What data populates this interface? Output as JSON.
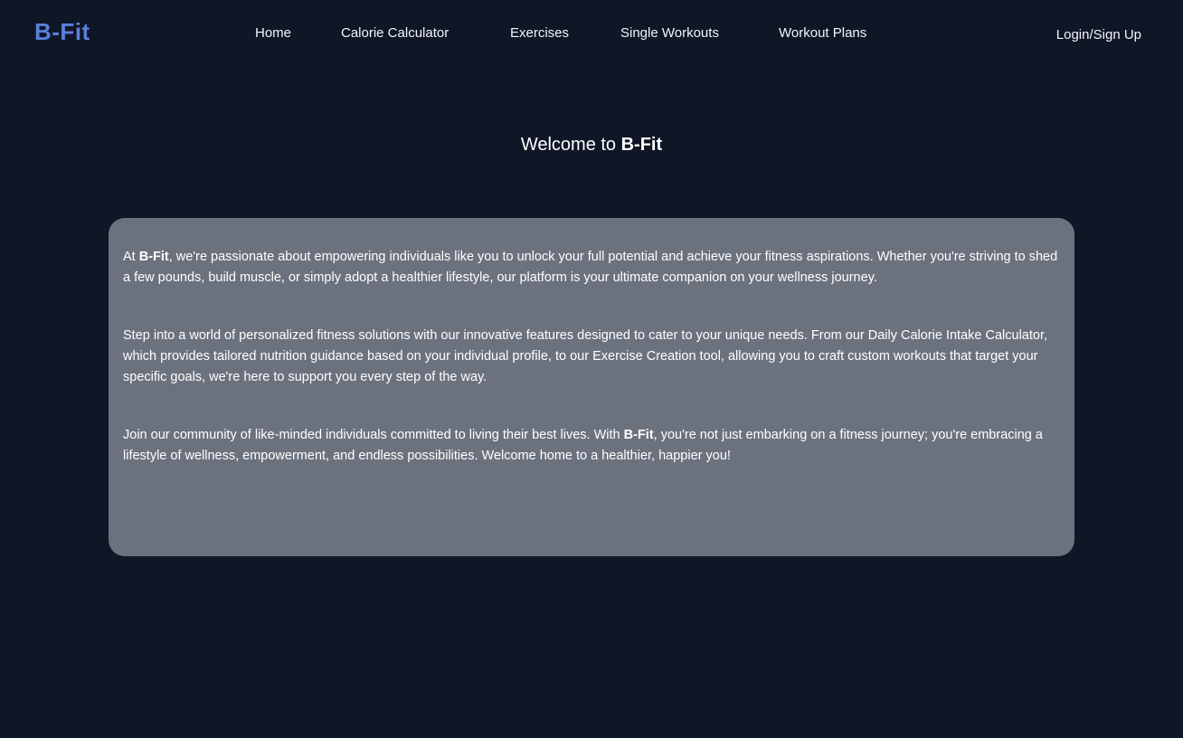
{
  "brand": {
    "name": "B-Fit",
    "color": "#5b7fdc"
  },
  "nav": {
    "items": [
      {
        "label": "Home"
      },
      {
        "label": "Calorie Calculator"
      },
      {
        "label": "Exercises"
      },
      {
        "label": "Single Workouts"
      },
      {
        "label": "Workout Plans"
      }
    ],
    "login_label": "Login/Sign Up"
  },
  "hero": {
    "prefix": "Welcome to ",
    "brand": "B-Fit"
  },
  "about": {
    "p1": {
      "pre": "At ",
      "brand": "B-Fit",
      "post": ", we're passionate about empowering individuals like you to unlock your full potential and achieve your fitness aspirations. Whether you're striving to shed a few pounds, build muscle, or simply adopt a healthier lifestyle, our platform is your ultimate companion on your wellness journey."
    },
    "p2": "Step into a world of personalized fitness solutions with our innovative features designed to cater to your unique needs. From our Daily Calorie Intake Calculator, which provides tailored nutrition guidance based on your individual profile, to our Exercise Creation tool, allowing you to craft custom workouts that target your specific goals, we're here to support you every step of the way.",
    "p3": {
      "pre": "Join our community of like-minded individuals committed to living their best lives. With ",
      "brand": "B-Fit",
      "post": ", you're not just embarking on a fitness journey; you're embracing a lifestyle of wellness, empowerment, and endless possibilities. Welcome home to a healthier, happier you!"
    }
  },
  "colors": {
    "background": "#0f1626",
    "card": "#6b727e",
    "text": "#ffffff"
  }
}
